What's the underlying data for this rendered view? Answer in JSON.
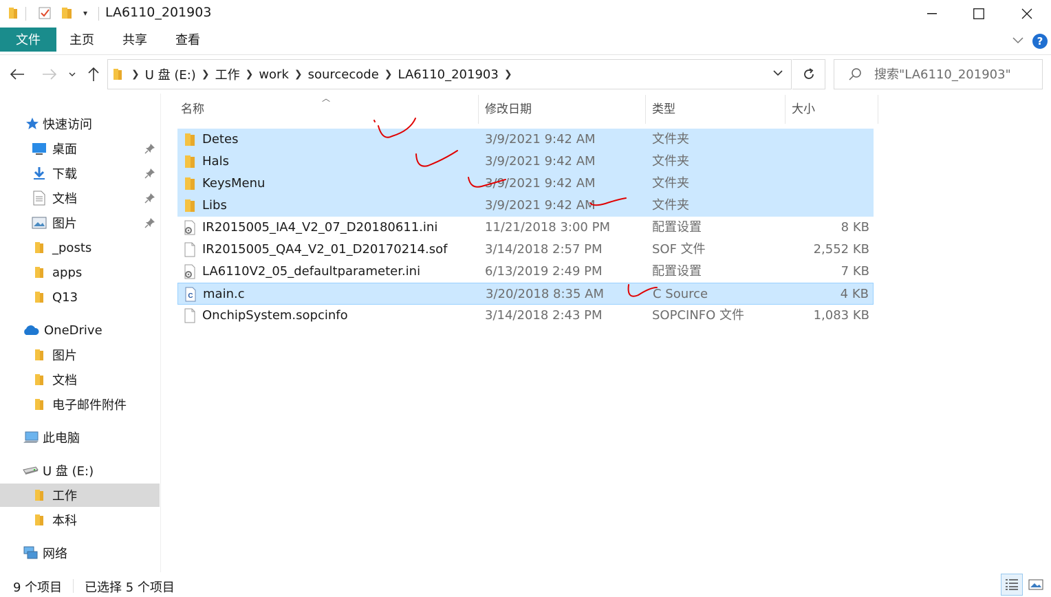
{
  "window": {
    "title": "LA6110_201903"
  },
  "ribbon": {
    "tabs": [
      "文件",
      "主页",
      "共享",
      "查看"
    ]
  },
  "address": {
    "crumbs": [
      "U 盘 (E:)",
      "工作",
      "work",
      "sourcecode",
      "LA6110_201903"
    ]
  },
  "search": {
    "placeholder": "搜索\"LA6110_201903\""
  },
  "navpane": {
    "quick_access": "快速访问",
    "items": [
      {
        "label": "桌面",
        "icon": "desktop-icon",
        "pinned": true
      },
      {
        "label": "下载",
        "icon": "download-icon",
        "pinned": true
      },
      {
        "label": "文档",
        "icon": "document-icon",
        "pinned": true
      },
      {
        "label": "图片",
        "icon": "picture-icon",
        "pinned": true
      },
      {
        "label": "_posts",
        "icon": "folder-icon",
        "pinned": false
      },
      {
        "label": "apps",
        "icon": "folder-icon",
        "pinned": false
      },
      {
        "label": "Q13",
        "icon": "folder-icon",
        "pinned": false
      }
    ],
    "onedrive": "OneDrive",
    "onedrive_items": [
      "图片",
      "文档",
      "电子邮件附件"
    ],
    "this_pc": "此电脑",
    "drive": "U 盘 (E:)",
    "drive_items": [
      "工作",
      "本科"
    ],
    "network": "网络"
  },
  "columns": {
    "name": "名称",
    "date": "修改日期",
    "type": "类型",
    "size": "大小"
  },
  "files": [
    {
      "name": "Detes",
      "date": "3/9/2021 9:42 AM",
      "type": "文件夹",
      "size": "",
      "icon": "folder-icon",
      "selected": true
    },
    {
      "name": "Hals",
      "date": "3/9/2021 9:42 AM",
      "type": "文件夹",
      "size": "",
      "icon": "folder-icon",
      "selected": true
    },
    {
      "name": "KeysMenu",
      "date": "3/9/2021 9:42 AM",
      "type": "文件夹",
      "size": "",
      "icon": "folder-icon",
      "selected": true
    },
    {
      "name": "Libs",
      "date": "3/9/2021 9:42 AM",
      "type": "文件夹",
      "size": "",
      "icon": "folder-icon",
      "selected": true
    },
    {
      "name": "IR2015005_IA4_V2_07_D20180611.ini",
      "date": "11/21/2018 3:00 PM",
      "type": "配置设置",
      "size": "8 KB",
      "icon": "settings-file-icon",
      "selected": false
    },
    {
      "name": "IR2015005_QA4_V2_01_D20170214.sof",
      "date": "3/14/2018 2:57 PM",
      "type": "SOF 文件",
      "size": "2,552 KB",
      "icon": "blank-file-icon",
      "selected": false
    },
    {
      "name": "LA6110V2_05_defaultparameter.ini",
      "date": "6/13/2019 2:49 PM",
      "type": "配置设置",
      "size": "7 KB",
      "icon": "settings-file-icon",
      "selected": false
    },
    {
      "name": "main.c",
      "date": "3/20/2018 8:35 AM",
      "type": "C Source",
      "size": "4 KB",
      "icon": "c-source-file-icon",
      "selected": true
    },
    {
      "name": "OnchipSystem.sopcinfo",
      "date": "3/14/2018 2:43 PM",
      "type": "SOPCINFO 文件",
      "size": "1,083 KB",
      "icon": "blank-file-icon",
      "selected": false
    }
  ],
  "status": {
    "count": "9 个项目",
    "selected": "已选择 5 个项目"
  },
  "colors": {
    "accent": "#1a8c8c",
    "selection": "#cce8ff",
    "annotation": "#e00000"
  }
}
